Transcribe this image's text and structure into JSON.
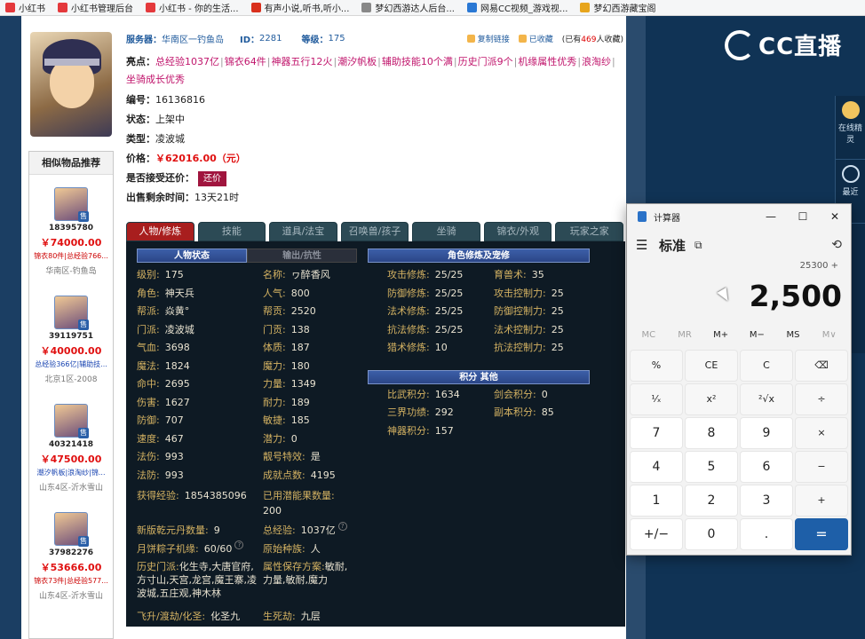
{
  "bookmarks": [
    {
      "icon": "xiaohongshu-icon",
      "color": "#e4393c",
      "label": "小红书"
    },
    {
      "icon": "xiaohongshu-icon",
      "color": "#e4393c",
      "label": "小红书管理后台"
    },
    {
      "icon": "xiaohongshu-icon",
      "color": "#e4393c",
      "label": "小红书 - 你的生活..."
    },
    {
      "icon": "audio-icon",
      "color": "#d9301d",
      "label": "有声小说,听书,听小..."
    },
    {
      "icon": "page-icon",
      "color": "#888888",
      "label": "梦幻西游达人后台..."
    },
    {
      "icon": "netease-cc-icon",
      "color": "#2a78d4",
      "label": "网易CC视频_游戏视..."
    },
    {
      "icon": "treasure-icon",
      "color": "#e7a51d",
      "label": "梦幻西游藏宝阁"
    }
  ],
  "item": {
    "server_label": "服务器：",
    "server": "华南区一钓鱼岛",
    "id_label": "ID：",
    "id": "2281",
    "level_label": "等级：",
    "level": "175",
    "copy_link": "复制链接",
    "collected": "已收藏",
    "collect_count_prefix": "(已有",
    "collect_count": "469",
    "collect_count_suffix": "人收藏)",
    "highlights_label": "亮点：",
    "highlights": [
      "总经验1037亿",
      "锦衣64件",
      "神器五行12火",
      "潮汐帆板",
      "辅助技能10个满",
      "历史门派9个",
      "机缘属性优秀",
      "浪淘纱",
      "坐骑成长优秀"
    ],
    "serial_label": "编号：",
    "serial": "16136816",
    "status_label": "状态：",
    "status": "上架中",
    "type_label": "类型：",
    "type": "凌波城",
    "price_label": "价格：",
    "price": "￥62016.00（元）",
    "counter_label": "是否接受还价：",
    "counter_btn": "还价",
    "time_left_label": "出售剩余时间：",
    "time_left": "13天21时"
  },
  "similar": {
    "title": "相似物品推荐",
    "items": [
      {
        "id": "18395780",
        "price": "￥74000.00",
        "tags": "锦衣80件|总经验766...",
        "tag_color": "red",
        "server": "华南区-钓鱼岛"
      },
      {
        "id": "39119751",
        "price": "￥40000.00",
        "tags": "总经验366亿|辅助技...",
        "tag_color": "blue",
        "server": "北京1区-2008"
      },
      {
        "id": "40321418",
        "price": "￥47500.00",
        "tags": "潮汐帆板|浪淘纱|锦...",
        "tag_color": "blue",
        "server": "山东4区-沂水雪山"
      },
      {
        "id": "37982276",
        "price": "￥53666.00",
        "tags": "锦衣73件|总经验577...",
        "tag_color": "red",
        "server": "山东4区-沂水雪山"
      }
    ],
    "badge": "售"
  },
  "tabs": [
    "人物/修炼",
    "技能",
    "道具/法宝",
    "召唤兽/孩子",
    "坐骑",
    "锦衣/外观",
    "玩家之家"
  ],
  "panel": {
    "left_headers": [
      "人物状态",
      "输出/抗性"
    ],
    "stats_left": [
      [
        "级别:",
        "175",
        "名称:",
        "ヮ醉香风"
      ],
      [
        "角色:",
        "神天兵",
        "人气:",
        "800"
      ],
      [
        "帮派:",
        "焱黄°",
        "帮贡:",
        "2520"
      ],
      [
        "门派:",
        "凌波城",
        "门贡:",
        "138"
      ],
      [
        "气血:",
        "3698",
        "体质:",
        "187"
      ],
      [
        "魔法:",
        "1824",
        "魔力:",
        "180"
      ],
      [
        "命中:",
        "2695",
        "力量:",
        "1349"
      ],
      [
        "伤害:",
        "1627",
        "耐力:",
        "189"
      ],
      [
        "防御:",
        "707",
        "敏捷:",
        "185"
      ],
      [
        "速度:",
        "467",
        "潜力:",
        "0"
      ],
      [
        "法伤:",
        "993",
        "靓号特效:",
        "是"
      ],
      [
        "法防:",
        "993",
        "成就点数:",
        "4195"
      ]
    ],
    "exp_label": "获得经验:",
    "exp": "1854385096",
    "potential_label": "已用潜能果数量:",
    "potential": "200",
    "qiankun_label": "新版乾元丹数量:",
    "qiankun": "9",
    "total_exp_label": "总经验:",
    "total_exp": "1037亿",
    "mooncake_label": "月饼粽子机缘:",
    "mooncake": "60/60",
    "origin_label": "原始种族:",
    "origin": "人",
    "history_label": "历史门派:",
    "history": "化生寺,大唐官府,方寸山,天宫,龙宫,魔王寨,凌波城,五庄观,神木林",
    "attr_label": "属性保存方案:",
    "attr": "敏耐,力量,敏耐,魔力",
    "ascend_label": "飞升/渡劫/化圣:",
    "ascend": "化圣九",
    "life_label": "生死劫:",
    "life": "九层",
    "right_header": "角色修炼及宠修",
    "cultivation": [
      [
        "攻击修炼:",
        "25/25",
        "育兽术:",
        "35"
      ],
      [
        "防御修炼:",
        "25/25",
        "攻击控制力:",
        "25"
      ],
      [
        "法术修炼:",
        "25/25",
        "防御控制力:",
        "25"
      ],
      [
        "抗法修炼:",
        "25/25",
        "法术控制力:",
        "25"
      ],
      [
        "猎术修炼:",
        "10",
        "抗法控制力:",
        "25"
      ]
    ],
    "score_header": "积分  其他",
    "scores": [
      [
        "比武积分:",
        "1634",
        "剑会积分:",
        "0"
      ],
      [
        "三界功绩:",
        "292",
        "副本积分:",
        "85"
      ],
      [
        "神器积分:",
        "157",
        "",
        ""
      ]
    ]
  },
  "cc": {
    "logo": "CC直播",
    "side": [
      {
        "icon": "elf-icon",
        "label": "在线精灵"
      },
      {
        "icon": "clock-icon",
        "label": "最近"
      }
    ]
  },
  "calculator": {
    "window_title": "计算器",
    "mode": "标准",
    "expression": "25300 +",
    "display": "2,500",
    "memory": [
      {
        "label": "MC",
        "enabled": false
      },
      {
        "label": "MR",
        "enabled": false
      },
      {
        "label": "M+",
        "enabled": true
      },
      {
        "label": "M−",
        "enabled": true
      },
      {
        "label": "MS",
        "enabled": true
      },
      {
        "label": "M∨",
        "enabled": false
      }
    ],
    "keys": [
      {
        "label": "%",
        "kind": "fn",
        "name": "percent-key"
      },
      {
        "label": "CE",
        "kind": "fn",
        "name": "clear-entry-key"
      },
      {
        "label": "C",
        "kind": "fn",
        "name": "clear-key"
      },
      {
        "label": "⌫",
        "kind": "fn",
        "name": "backspace-key"
      },
      {
        "label": "¹⁄ₓ",
        "kind": "fn",
        "name": "reciprocal-key"
      },
      {
        "label": "x²",
        "kind": "fn",
        "name": "square-key"
      },
      {
        "label": "²√x",
        "kind": "fn",
        "name": "sqrt-key"
      },
      {
        "label": "÷",
        "kind": "fn",
        "name": "divide-key"
      },
      {
        "label": "7",
        "kind": "num",
        "name": "digit-7-key"
      },
      {
        "label": "8",
        "kind": "num",
        "name": "digit-8-key"
      },
      {
        "label": "9",
        "kind": "num",
        "name": "digit-9-key"
      },
      {
        "label": "×",
        "kind": "fn",
        "name": "multiply-key"
      },
      {
        "label": "4",
        "kind": "num",
        "name": "digit-4-key"
      },
      {
        "label": "5",
        "kind": "num",
        "name": "digit-5-key"
      },
      {
        "label": "6",
        "kind": "num",
        "name": "digit-6-key"
      },
      {
        "label": "−",
        "kind": "fn",
        "name": "minus-key"
      },
      {
        "label": "1",
        "kind": "num",
        "name": "digit-1-key"
      },
      {
        "label": "2",
        "kind": "num",
        "name": "digit-2-key"
      },
      {
        "label": "3",
        "kind": "num",
        "name": "digit-3-key"
      },
      {
        "label": "+",
        "kind": "fn",
        "name": "plus-key"
      },
      {
        "label": "+/−",
        "kind": "num",
        "name": "negate-key"
      },
      {
        "label": "0",
        "kind": "num",
        "name": "digit-0-key"
      },
      {
        "label": ".",
        "kind": "num",
        "name": "decimal-key"
      },
      {
        "label": "=",
        "kind": "eq",
        "name": "equals-key"
      }
    ]
  }
}
